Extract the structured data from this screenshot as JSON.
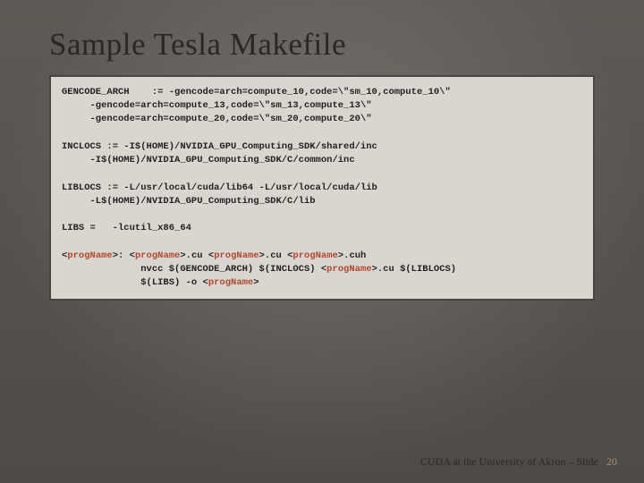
{
  "title": "Sample Tesla Makefile",
  "code": {
    "l1": "GENCODE_ARCH    := -gencode=arch=compute_10,code=\\\"sm_10,compute_10\\\"",
    "l2": "     -gencode=arch=compute_13,code=\\\"sm_13,compute_13\\\"",
    "l3": "     -gencode=arch=compute_20,code=\\\"sm_20,compute_20\\\"",
    "l4": "",
    "l5": "INCLOCS := -I$(HOME)/NVIDIA_GPU_Computing_SDK/shared/inc",
    "l6": "     -I$(HOME)/NVIDIA_GPU_Computing_SDK/C/common/inc",
    "l7": "",
    "l8": "LIBLOCS := -L/usr/local/cuda/lib64 -L/usr/local/cuda/lib",
    "l9": "     -L$(HOME)/NVIDIA_GPU_Computing_SDK/C/lib",
    "l10": "",
    "l11": "LIBS =   -lcutil_x86_64",
    "l12": "",
    "prog": "progName",
    "p1_a": "<",
    "p1_b": ">: <",
    "p1_c": ">.cu <",
    "p1_d": ">.cu <",
    "p1_e": ">.cuh",
    "p2_a": "              nvcc $(GENCODE_ARCH) $(INCLOCS) <",
    "p2_b": ">.cu $(LIBLOCS)",
    "p3_a": "              $(LIBS) -o <",
    "p3_b": ">"
  },
  "footer": {
    "text": "CUDA at the University of Akron – Slide",
    "num": "20"
  }
}
